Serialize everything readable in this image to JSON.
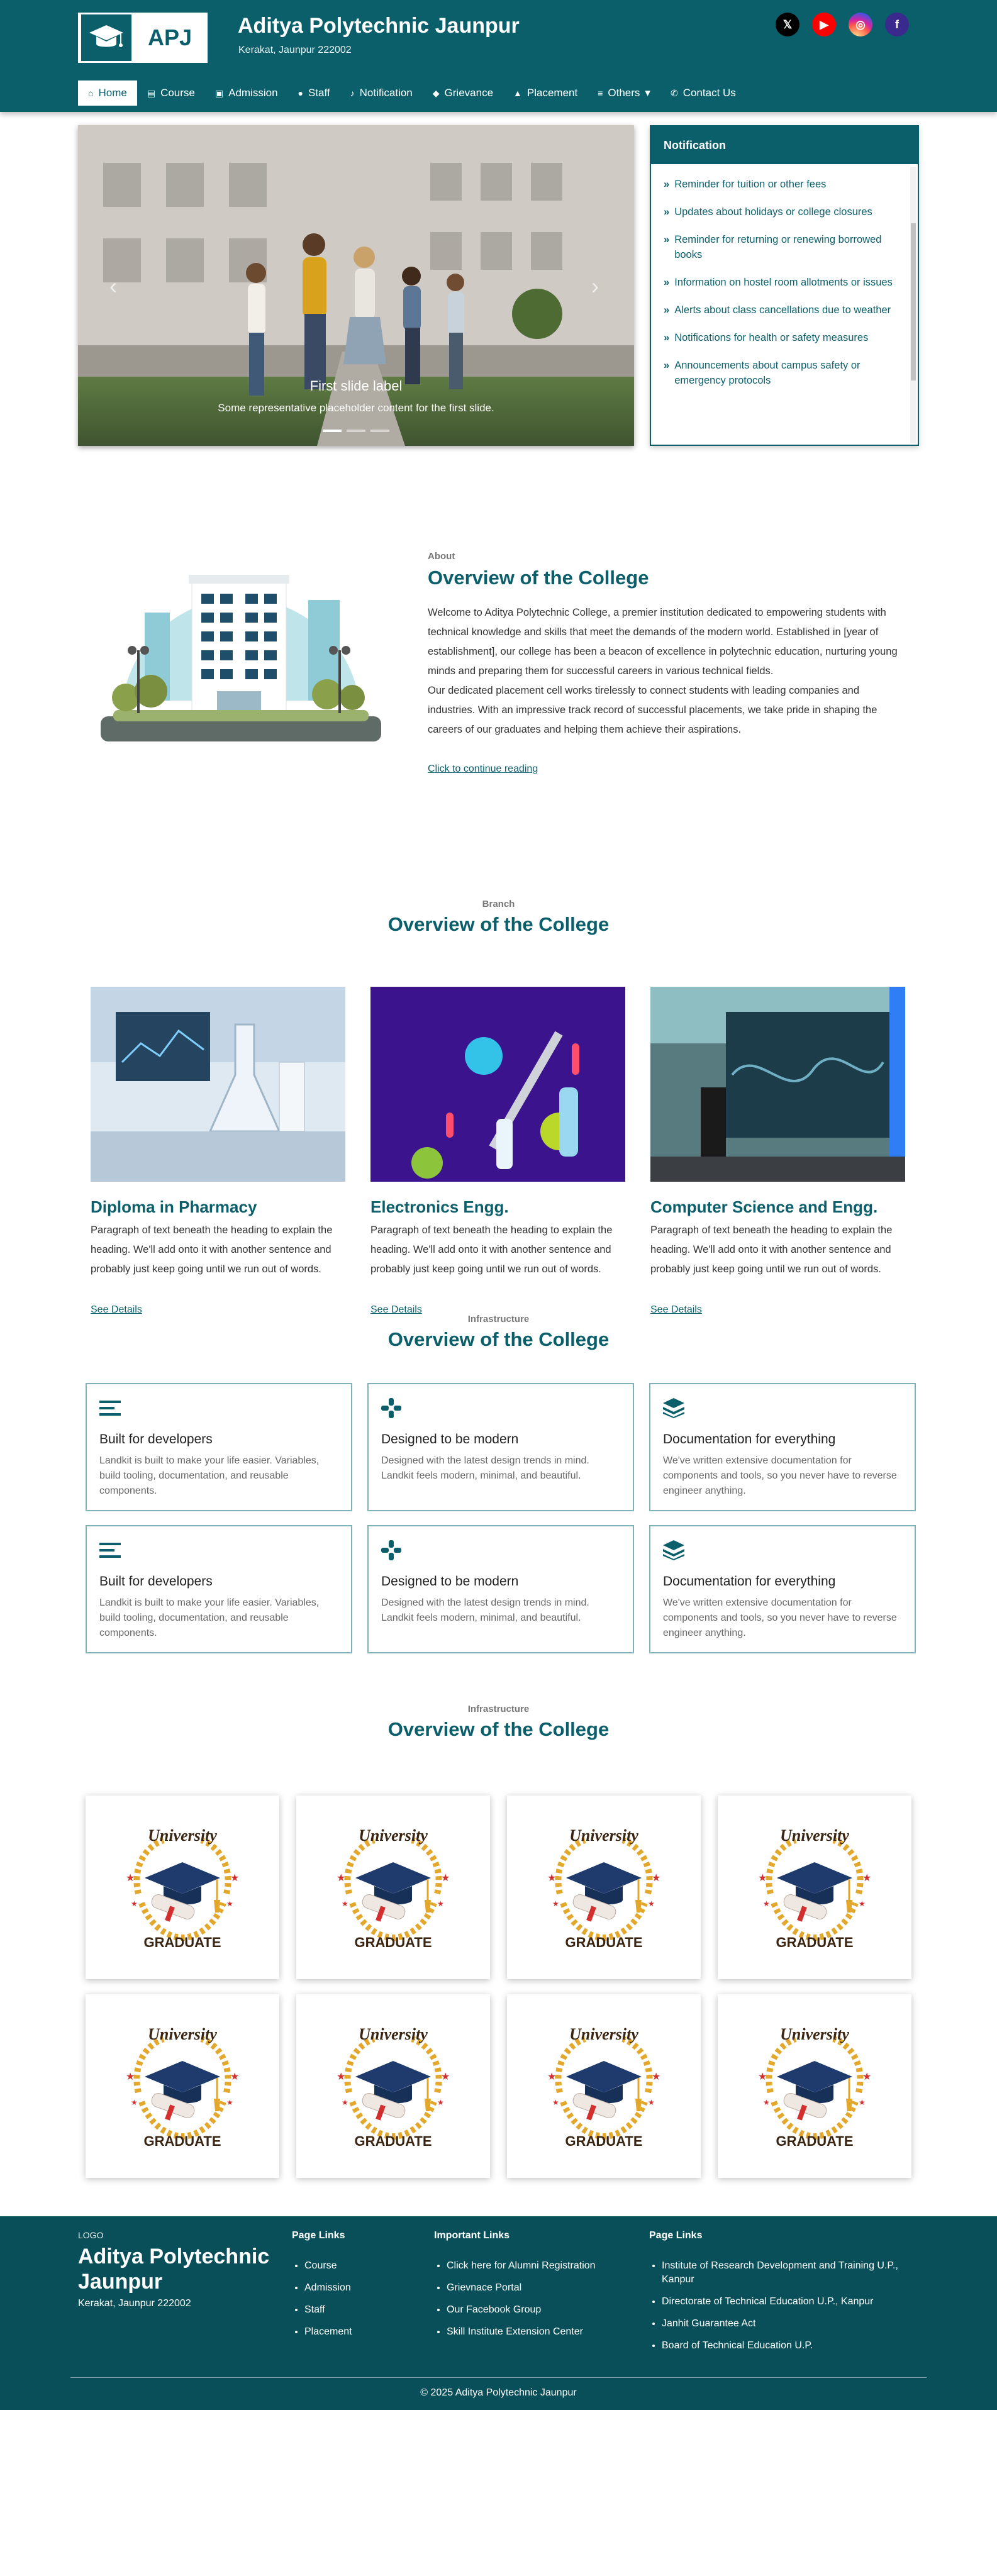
{
  "header": {
    "logo_text": "APJ",
    "title": "Aditya Polytechnic Jaunpur",
    "subtitle": "Kerakat, Jaunpur 222002",
    "socials": [
      {
        "name": "x",
        "glyph": "𝕏",
        "color": "#000000"
      },
      {
        "name": "youtube",
        "glyph": "▶",
        "color": "#ff0000"
      },
      {
        "name": "instagram",
        "glyph": "◎",
        "color": "#d6249f"
      },
      {
        "name": "facebook",
        "glyph": "f",
        "color": "#3b2a8d"
      }
    ]
  },
  "nav": {
    "items": [
      {
        "label": "Home",
        "icon": "home-icon",
        "glyph": "⌂"
      },
      {
        "label": "Course",
        "icon": "book-icon",
        "glyph": "▤"
      },
      {
        "label": "Admission",
        "icon": "briefcase-icon",
        "glyph": "▣"
      },
      {
        "label": "Staff",
        "icon": "person-icon",
        "glyph": "●"
      },
      {
        "label": "Notification",
        "icon": "bell-icon",
        "glyph": "♪"
      },
      {
        "label": "Grievance",
        "icon": "megaphone-icon",
        "glyph": "◆"
      },
      {
        "label": "Placement",
        "icon": "graduation-cap-icon",
        "glyph": "▲"
      },
      {
        "label": "Others",
        "icon": "list-icon",
        "glyph": "≡",
        "dropdown": "▾"
      },
      {
        "label": "Contact Us",
        "icon": "phone-icon",
        "glyph": "✆"
      }
    ]
  },
  "carousel": {
    "caption_title": "First slide label",
    "caption_text": "Some representative placeholder content for the first slide.",
    "prev_glyph": "‹",
    "next_glyph": "›"
  },
  "notification": {
    "title": "Notification",
    "chevron": "»",
    "items": [
      "Reminder for tuition or other fees",
      "Updates about holidays or college closures",
      "Reminder for returning or renewing borrowed books",
      "Information on hostel room allotments or issues",
      "Alerts about class cancellations due to weather",
      "Notifications for health or safety measures",
      "Announcements about campus safety or emergency protocols"
    ]
  },
  "about": {
    "eyebrow": "About",
    "title": "Overview of the College",
    "paragraph1": "Welcome to Aditya Polytechnic College, a premier institution dedicated to empowering students with technical knowledge and skills that meet the demands of the modern world. Established in [year of establishment], our college has been a beacon of excellence in polytechnic education, nurturing young minds and preparing them for successful careers in various technical fields.",
    "paragraph2": "Our dedicated placement cell works tirelessly to connect students with leading companies and industries. With an impressive track record of successful placements, we take pride in shaping the careers of our graduates and helping them achieve their aspirations.",
    "link": "Click to continue reading"
  },
  "branch": {
    "eyebrow": "Branch",
    "title": "Overview of the College",
    "cards": [
      {
        "title": "Diploma in Pharmacy",
        "desc": "Paragraph of text beneath the heading to explain the heading. We'll add onto it with another sentence and probably just keep going until we run out of words.",
        "link": "See Details"
      },
      {
        "title": "Electronics Engg.",
        "desc": "Paragraph of text beneath the heading to explain the heading. We'll add onto it with another sentence and probably just keep going until we run out of words.",
        "link": "See Details"
      },
      {
        "title": "Computer Science and Engg.",
        "desc": "Paragraph of text beneath the heading to explain the heading. We'll add onto it with another sentence and probably just keep going until we run out of words.",
        "link": "See Details"
      }
    ]
  },
  "infra": {
    "eyebrow": "Infrastructure",
    "title": "Overview of the College",
    "features": [
      {
        "icon": "menu-icon",
        "title": "Built for developers",
        "desc": "Landkit is built to make your life easier. Variables, build tooling, documentation, and reusable components."
      },
      {
        "icon": "grid-icon",
        "title": "Designed to be modern",
        "desc": "Designed with the latest design trends in mind. Landkit feels modern, minimal, and beautiful."
      },
      {
        "icon": "layers-icon",
        "title": "Documentation for everything",
        "desc": "We've written extensive documentation for components and tools, so you never have to reverse engineer anything."
      },
      {
        "icon": "menu-icon",
        "title": "Built for developers",
        "desc": "Landkit is built to make your life easier. Variables, build tooling, documentation, and reusable components."
      },
      {
        "icon": "grid-icon",
        "title": "Designed to be modern",
        "desc": "Designed with the latest design trends in mind. Landkit feels modern, minimal, and beautiful."
      },
      {
        "icon": "layers-icon",
        "title": "Documentation for everything",
        "desc": "We've written extensive documentation for components and tools, so you never have to reverse engineer anything."
      }
    ]
  },
  "gallery": {
    "eyebrow": "Infrastructure",
    "title": "Overview of the College",
    "badge_top": "University",
    "badge_bottom": "GRADUATE",
    "count": 8
  },
  "footer": {
    "logo": "LOGO",
    "title": "Aditya Polytechnic Jaunpur",
    "subtitle": "Kerakat, Jaunpur 222002",
    "columns": [
      {
        "head": "Page Links",
        "items": [
          "Course",
          "Admission",
          "Staff",
          "Placement"
        ]
      },
      {
        "head": "Important Links",
        "items": [
          "Click here for Alumni Registration",
          "Grievnace Portal",
          "Our Facebook Group",
          "Skill Institute Extension Center"
        ]
      },
      {
        "head": "Page Links",
        "items": [
          "Institute of Research Development and Training U.P., Kanpur",
          "Directorate of Technical Education U.P., Kanpur",
          "Janhit Guarantee Act",
          "Board of Technical Education U.P."
        ]
      }
    ],
    "copyright": "© 2025 Aditya Polytechnic Jaunpur"
  },
  "colors": {
    "brand": "#0b5f6b",
    "brand_dark": "#094f59"
  }
}
